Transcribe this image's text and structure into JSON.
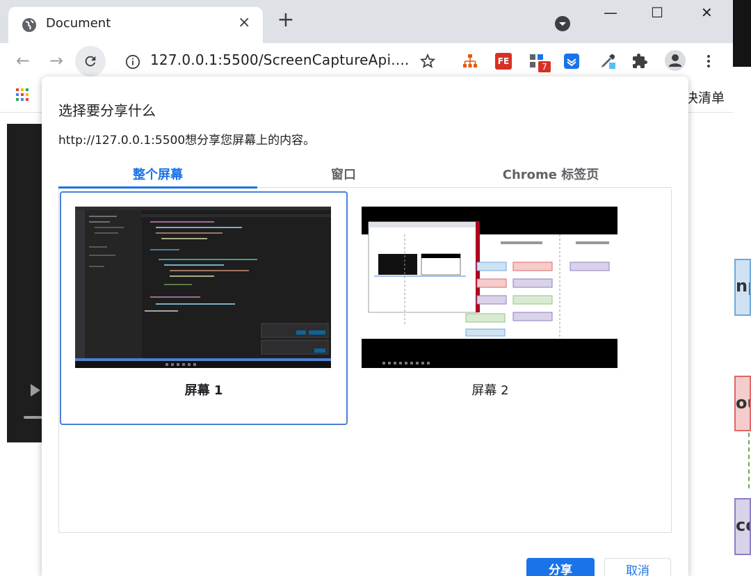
{
  "browser": {
    "tab_title": "Document",
    "tab_close": "×",
    "new_tab": "+",
    "url": "127.0.0.1:5500/ScreenCaptureApi....",
    "window_controls": {
      "minimize": "—",
      "maximize": "☐",
      "close": "✕"
    },
    "nav": {
      "back": "←",
      "forward": "→"
    },
    "bookmarks_right_text": "决清单",
    "extensions": [
      "org-chart-icon",
      "fe-extension-icon",
      "tabs-extension-icon",
      "todo-extension-icon",
      "eyedropper-icon",
      "puzzle-icon",
      "profile-icon",
      "menu-icon"
    ],
    "extension_badge": "7",
    "fe_label": "FE"
  },
  "background": {
    "right_box_texts": [
      "npo",
      "ou",
      "co"
    ]
  },
  "dialog": {
    "title": "选择要分享什么",
    "description": "http://127.0.0.1:5500想分享您屏幕上的内容。",
    "tabs": [
      {
        "label": "整个屏幕",
        "selected": true
      },
      {
        "label": "窗口",
        "selected": false
      },
      {
        "label": "Chrome 标签页",
        "selected": false
      }
    ],
    "screens": [
      {
        "label": "屏幕 1",
        "selected": true
      },
      {
        "label": "屏幕 2",
        "selected": false
      }
    ],
    "share_button": "分享",
    "cancel_button": "取消"
  },
  "colors": {
    "accent": "#1a73e8",
    "selected_border": "#4a7fd6",
    "tabstrip": "#dee1e6"
  }
}
